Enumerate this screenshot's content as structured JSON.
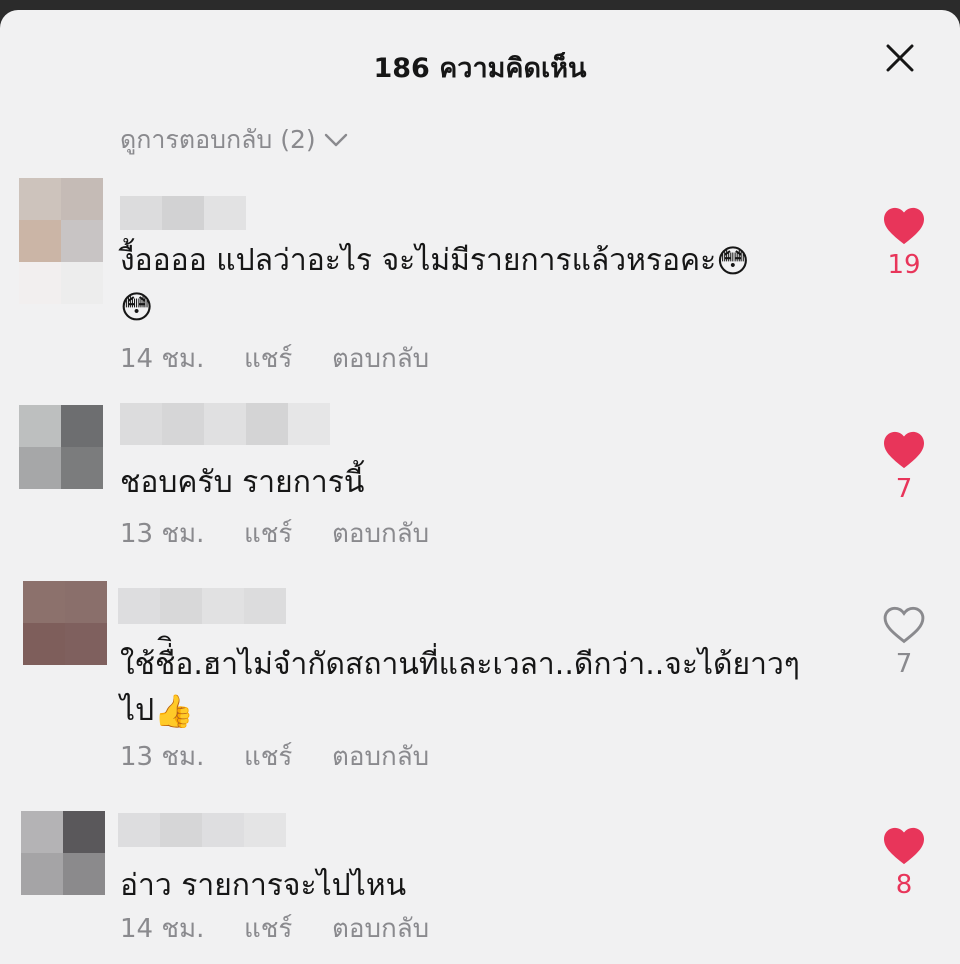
{
  "header": {
    "title": "186 ความคิดเห็น",
    "close_icon": "close-icon"
  },
  "view_replies": {
    "label": "ดูการตอบกลับ (2)",
    "icon": "chevron-down-icon"
  },
  "comments": [
    {
      "text": "งื้ออออ แปลว่าอะไร จะไม่มีรายการแล้วหรอคะ",
      "emoji": [
        "😳",
        "😳"
      ],
      "time": "14 ชม.",
      "share_label": "แชร์",
      "reply_label": "ตอบกลับ",
      "likes": "19",
      "liked": true,
      "avatar_colors": [
        "#cdc3bc",
        "#c5bbb6",
        "#cbb5a6",
        "#c8c4c4",
        "#f2efef",
        "#ededed"
      ]
    },
    {
      "text": "ชอบครับ รายการนี้",
      "time": "13 ชม.",
      "share_label": "แชร์",
      "reply_label": "ตอบกลับ",
      "likes": "7",
      "liked": true,
      "avatar_colors": [
        "#bdbfbf",
        "#6d6e70",
        "#a6a7a8",
        "#7b7c7d"
      ]
    },
    {
      "text": "ใช้ชื่ิอ.ฮาไม่จำกัดสถานที่และเวลา..ดีกว่า..จะได้ยาวๆไป",
      "emoji": [
        "👍"
      ],
      "time": "13 ชม.",
      "share_label": "แชร์",
      "reply_label": "ตอบกลับ",
      "likes": "7",
      "liked": false,
      "avatar_colors": [
        "#8c716c",
        "#8a6f6b",
        "#7e5e5b",
        "#7f605e"
      ]
    },
    {
      "text": "อ่าว รายการจะไปไหน",
      "time": "14 ชม.",
      "share_label": "แชร์",
      "reply_label": "ตอบกลับ",
      "likes": "8",
      "liked": true,
      "avatar_colors": [
        "#b4b3b5",
        "#5a585b",
        "#a5a4a6",
        "#8b8a8c"
      ]
    }
  ],
  "colors": {
    "accent_like": "#e8355a",
    "meta_text": "#8a8a8e",
    "sheet_background": "#f1f1f2"
  }
}
